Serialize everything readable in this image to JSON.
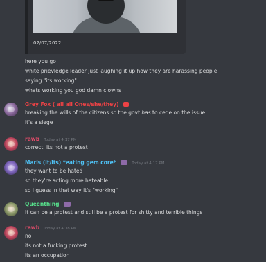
{
  "embed": {
    "date": "02/07/2022"
  },
  "plain_lines": [
    "here you go",
    "white prievledge leader just laughing it up how they are harassing people",
    "saying \"its working\"",
    "whats working you god damn clowns"
  ],
  "messages": [
    {
      "username": "Grey Fox ( all all Ones/she/they)",
      "username_color": "#ed4245",
      "timestamp": "Today at 4:16 PM",
      "lines": [
        "breaking the wills of the citizens so the govt has to cede on the issue",
        "it's a siege"
      ]
    },
    {
      "username": "rawb",
      "username_color": "#e34c6a",
      "timestamp": "Today at 4:17 PM",
      "lines": [
        "correct. its not a protest"
      ]
    },
    {
      "username": "Maris (it/its) *eating gem core*",
      "username_color": "#4fc3f7",
      "timestamp": "Today at 4:17 PM",
      "lines": [
        "they want to be hated",
        "so they're acting more hateable",
        "so i guess in that way it's \"working\""
      ]
    },
    {
      "username": "Queenthing",
      "username_color": "#57e08c",
      "timestamp": "Today at 4:17 PM",
      "lines": [
        "It can be a protest and still be a protest for shitty and terrible things"
      ]
    },
    {
      "username": "rawb",
      "username_color": "#e34c6a",
      "timestamp": "Today at 4:18 PM",
      "lines": [
        "no",
        "its not a fucking protest",
        "its an occupation"
      ]
    }
  ]
}
